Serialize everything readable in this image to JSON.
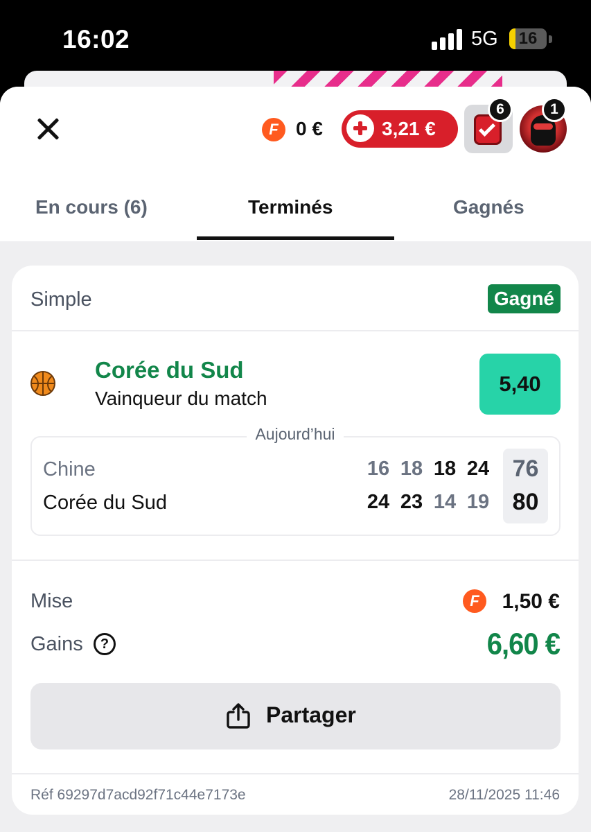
{
  "status_bar": {
    "time": "16:02",
    "network": "5G",
    "battery": "16"
  },
  "header": {
    "balance_icon": "F",
    "balance": "0 €",
    "bonus_amount": "3,21 €",
    "bets_badge": "6",
    "avatar_badge": "1"
  },
  "tabs": [
    {
      "label": "En cours (6)"
    },
    {
      "label": "Terminés"
    },
    {
      "label": "Gagnés"
    }
  ],
  "bet": {
    "type": "Simple",
    "status": "Gagné",
    "selection": "Corée du Sud",
    "market": "Vainqueur du match",
    "odds": "5,40",
    "score_date": "Aujourd’hui",
    "teams": [
      {
        "name": "Chine",
        "quarters": [
          "16",
          "18",
          "18",
          "24"
        ],
        "total": "76"
      },
      {
        "name": "Corée du Sud",
        "quarters": [
          "24",
          "23",
          "14",
          "19"
        ],
        "total": "80"
      }
    ],
    "stake_label": "Mise",
    "stake_icon": "F",
    "stake": "1,50 €",
    "winnings_label": "Gains",
    "help_icon": "?",
    "winnings": "6,60 €",
    "share_label": "Partager",
    "reference": "Réf 69297d7acd92f71c44e7173e",
    "date": "28/11/2025 11:46"
  },
  "colors": {
    "win_green": "#12864a",
    "odds_teal": "#27d3a8",
    "bonus_red": "#d81f2a",
    "coin_orange": "#ff5a1f",
    "accent_pink": "#e6177f"
  }
}
